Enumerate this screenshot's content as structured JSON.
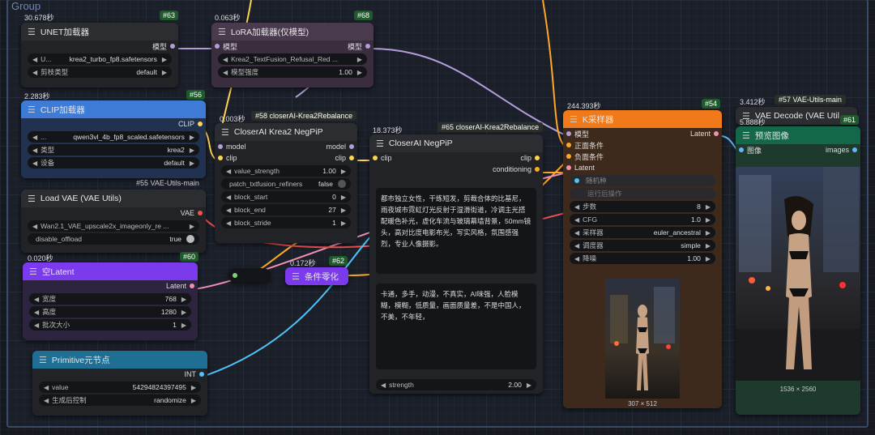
{
  "group": {
    "title": "Group"
  },
  "colors": {
    "model": "#b39ddb",
    "clip": "#ffd54f",
    "vae": "#ef5350",
    "latent": "#f48fb1",
    "cond": "#ffa726",
    "int": "#4fc3f7",
    "image": "#64b5f6"
  },
  "unet": {
    "timing": "30.678秒",
    "id": "#63",
    "title": "UNET加载器",
    "out_model": "模型",
    "w1_label": "U...",
    "w1_value": "krea2_turbo_fp8.safetensors",
    "w2_label": "剪枝类型",
    "w2_value": "default"
  },
  "lora": {
    "timing": "0.063秒",
    "id": "#68",
    "title": "LoRA加载器(仅模型)",
    "in_model": "模型",
    "out_model": "模型",
    "w1_value": "Krea2_TextFusion_Refusal_Red ...",
    "w2_label": "模型强度",
    "w2_value": "1.00"
  },
  "clip": {
    "timing": "2.283秒",
    "id": "#56",
    "title": "CLIP加载器",
    "out_clip": "CLIP",
    "w1_label": "...",
    "w1_value": "qwen3vl_4b_fp8_scaled.safetensors",
    "w2_label": "类型",
    "w2_value": "krea2",
    "w3_label": "设备",
    "w3_value": "default",
    "footer_badge": "#55 VAE-Utils-main"
  },
  "vae_load": {
    "title": "Load VAE (VAE Utils)",
    "out_vae": "VAE",
    "w1_value": "Wan2.1_VAE_upscale2x_imageonly_re ...",
    "w2_label": "disable_offload",
    "w2_value": "true"
  },
  "latent": {
    "timing": "0.020秒",
    "id": "#60",
    "title": "空Latent",
    "out_latent": "Latent",
    "w1_label": "宽度",
    "w1_value": "768",
    "w2_label": "高度",
    "w2_value": "1280",
    "w3_label": "批次大小",
    "w3_value": "1"
  },
  "primitive": {
    "title": "Primitive元节点",
    "out_int": "INT",
    "w1_label": "value",
    "w1_value": "54294824397495",
    "w2_label": "生成后控制",
    "w2_value": "randomize"
  },
  "negpip2": {
    "timing": "0.003秒",
    "badge": "#58 closerAI-Krea2Rebalance",
    "title": "CloserAI Krea2 NegPiP",
    "in_model": "model",
    "in_clip": "clip",
    "out_model": "model",
    "out_clip": "clip",
    "w1_label": "value_strength",
    "w1_value": "1.00",
    "w2_label": "patch_txtfusion_refiners",
    "w2_value": "false",
    "w3_label": "block_start",
    "w3_value": "0",
    "w4_label": "block_end",
    "w4_value": "27",
    "w5_label": "block_stride",
    "w5_value": "1"
  },
  "zero": {
    "timing": "0.172秒",
    "id": "#62",
    "title": "条件零化"
  },
  "negpip": {
    "timing": "18.373秒",
    "badge": "#65 closerAI-Krea2Rebalance",
    "title": "CloserAI NegPiP",
    "in_clip": "clip",
    "out_clip": "clip",
    "out_cond": "conditioning",
    "positive_text": "都市独立女性，干练短发，剪裁合体的比基尼，雨夜城市霓虹灯光反射于湿滑街道，冷调主光搭配暖色补光，虚化车流与玻璃幕墙背景，50mm镜头，高对比度电影布光，写实风格，氛围感强烈，专业人像摄影。",
    "negative_text": "卡通，多手，动漫，不真实，AI味强，人脸模糊，模糊，低质量，画面质量差，不是中国人，不美，不年轻，",
    "w_label": "strength",
    "w_value": "2.00"
  },
  "ksampler": {
    "timing": "244.393秒",
    "id": "#54",
    "title": "K采样器",
    "in_model": "模型",
    "in_pos": "正面条件",
    "in_neg": "负面条件",
    "in_latent": "Latent",
    "out_latent": "Latent",
    "seed_label": "随机种",
    "after_label": "运行后操作",
    "w1_label": "步数",
    "w1_value": "8",
    "w2_label": "CFG",
    "w2_value": "1.0",
    "w3_label": "采样器",
    "w3_value": "euler_ancestral",
    "w4_label": "调度器",
    "w4_value": "simple",
    "w5_label": "降噪",
    "w5_value": "1.00",
    "img_size": "307 × 512"
  },
  "vaedecode": {
    "timing": "3.412秒",
    "badge": "#57 VAE-Utils-main",
    "title": "VAE Decode (VAE Util"
  },
  "preview": {
    "timing": "5.888秒",
    "id": "#61",
    "title": "预览图像",
    "in_image": "图像",
    "out_images": "images",
    "img_size": "1536 × 2560"
  }
}
